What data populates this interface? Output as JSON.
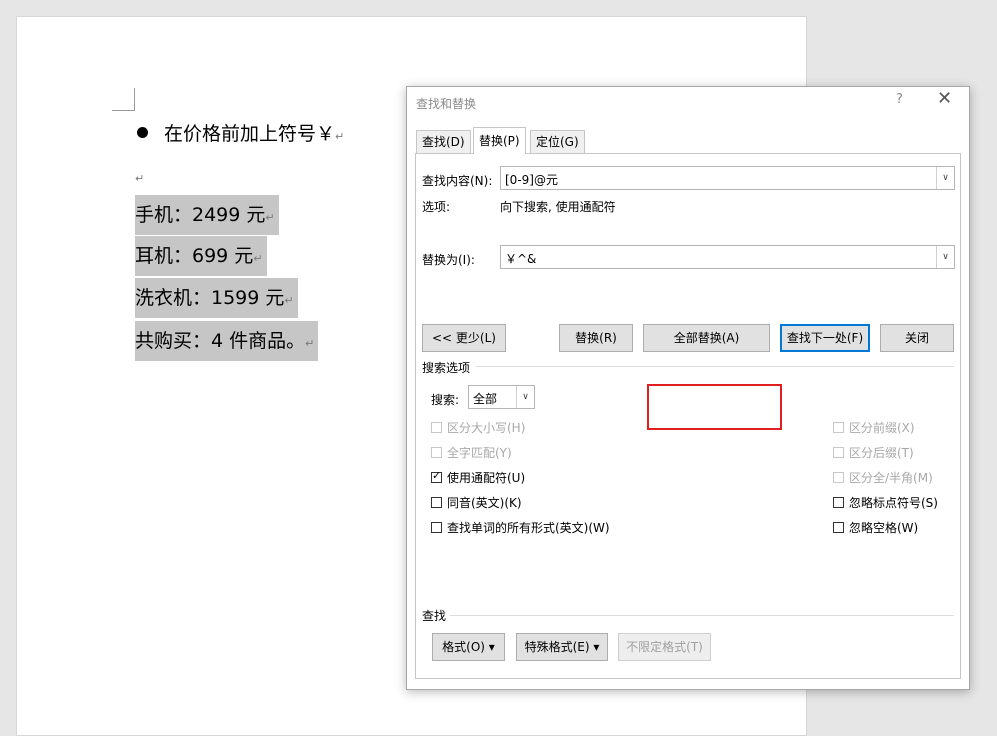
{
  "document": {
    "bullet_text": "在价格前加上符号￥",
    "para_mark": "↵",
    "lines": [
      "手机：2499 元",
      "耳机：699 元",
      "洗衣机：1599 元",
      "共购买：4 件商品。"
    ]
  },
  "dialog": {
    "title": "查找和替换",
    "help": "?",
    "close": "✕",
    "tabs": [
      "查找(D)",
      "替换(P)",
      "定位(G)"
    ],
    "find_label": "查找内容(N):",
    "find_value": "[0-9]@元",
    "options_label": "选项:",
    "options_value": "向下搜索, 使用通配符",
    "replace_label": "替换为(I):",
    "replace_value": "￥^&",
    "buttons": {
      "less": "<< 更少(L)",
      "replace": "替换(R)",
      "replace_all": "全部替换(A)",
      "find_next": "查找下一处(F)",
      "close": "关闭"
    },
    "search_options_title": "搜索选项",
    "search_label": "搜索:",
    "search_value": "全部",
    "left_checks": [
      {
        "label": "区分大小写(H)",
        "checked": false,
        "disabled": true
      },
      {
        "label": "全字匹配(Y)",
        "checked": false,
        "disabled": true
      },
      {
        "label": "使用通配符(U)",
        "checked": true,
        "disabled": false
      },
      {
        "label": "同音(英文)(K)",
        "checked": false,
        "disabled": false
      },
      {
        "label": "查找单词的所有形式(英文)(W)",
        "checked": false,
        "disabled": false
      }
    ],
    "right_checks": [
      {
        "label": "区分前缀(X)",
        "checked": false,
        "disabled": true
      },
      {
        "label": "区分后缀(T)",
        "checked": false,
        "disabled": true
      },
      {
        "label": "区分全/半角(M)",
        "checked": false,
        "disabled": true
      },
      {
        "label": "忽略标点符号(S)",
        "checked": false,
        "disabled": false
      },
      {
        "label": "忽略空格(W)",
        "checked": false,
        "disabled": false
      }
    ],
    "find_section_title": "查找",
    "bottom_buttons": {
      "format": "格式(O)",
      "special": "特殊格式(E)",
      "no_format": "不限定格式(T)"
    },
    "dropdown_arrow": "▾",
    "combo_arrow": "∨",
    "check_mark": "✓"
  }
}
